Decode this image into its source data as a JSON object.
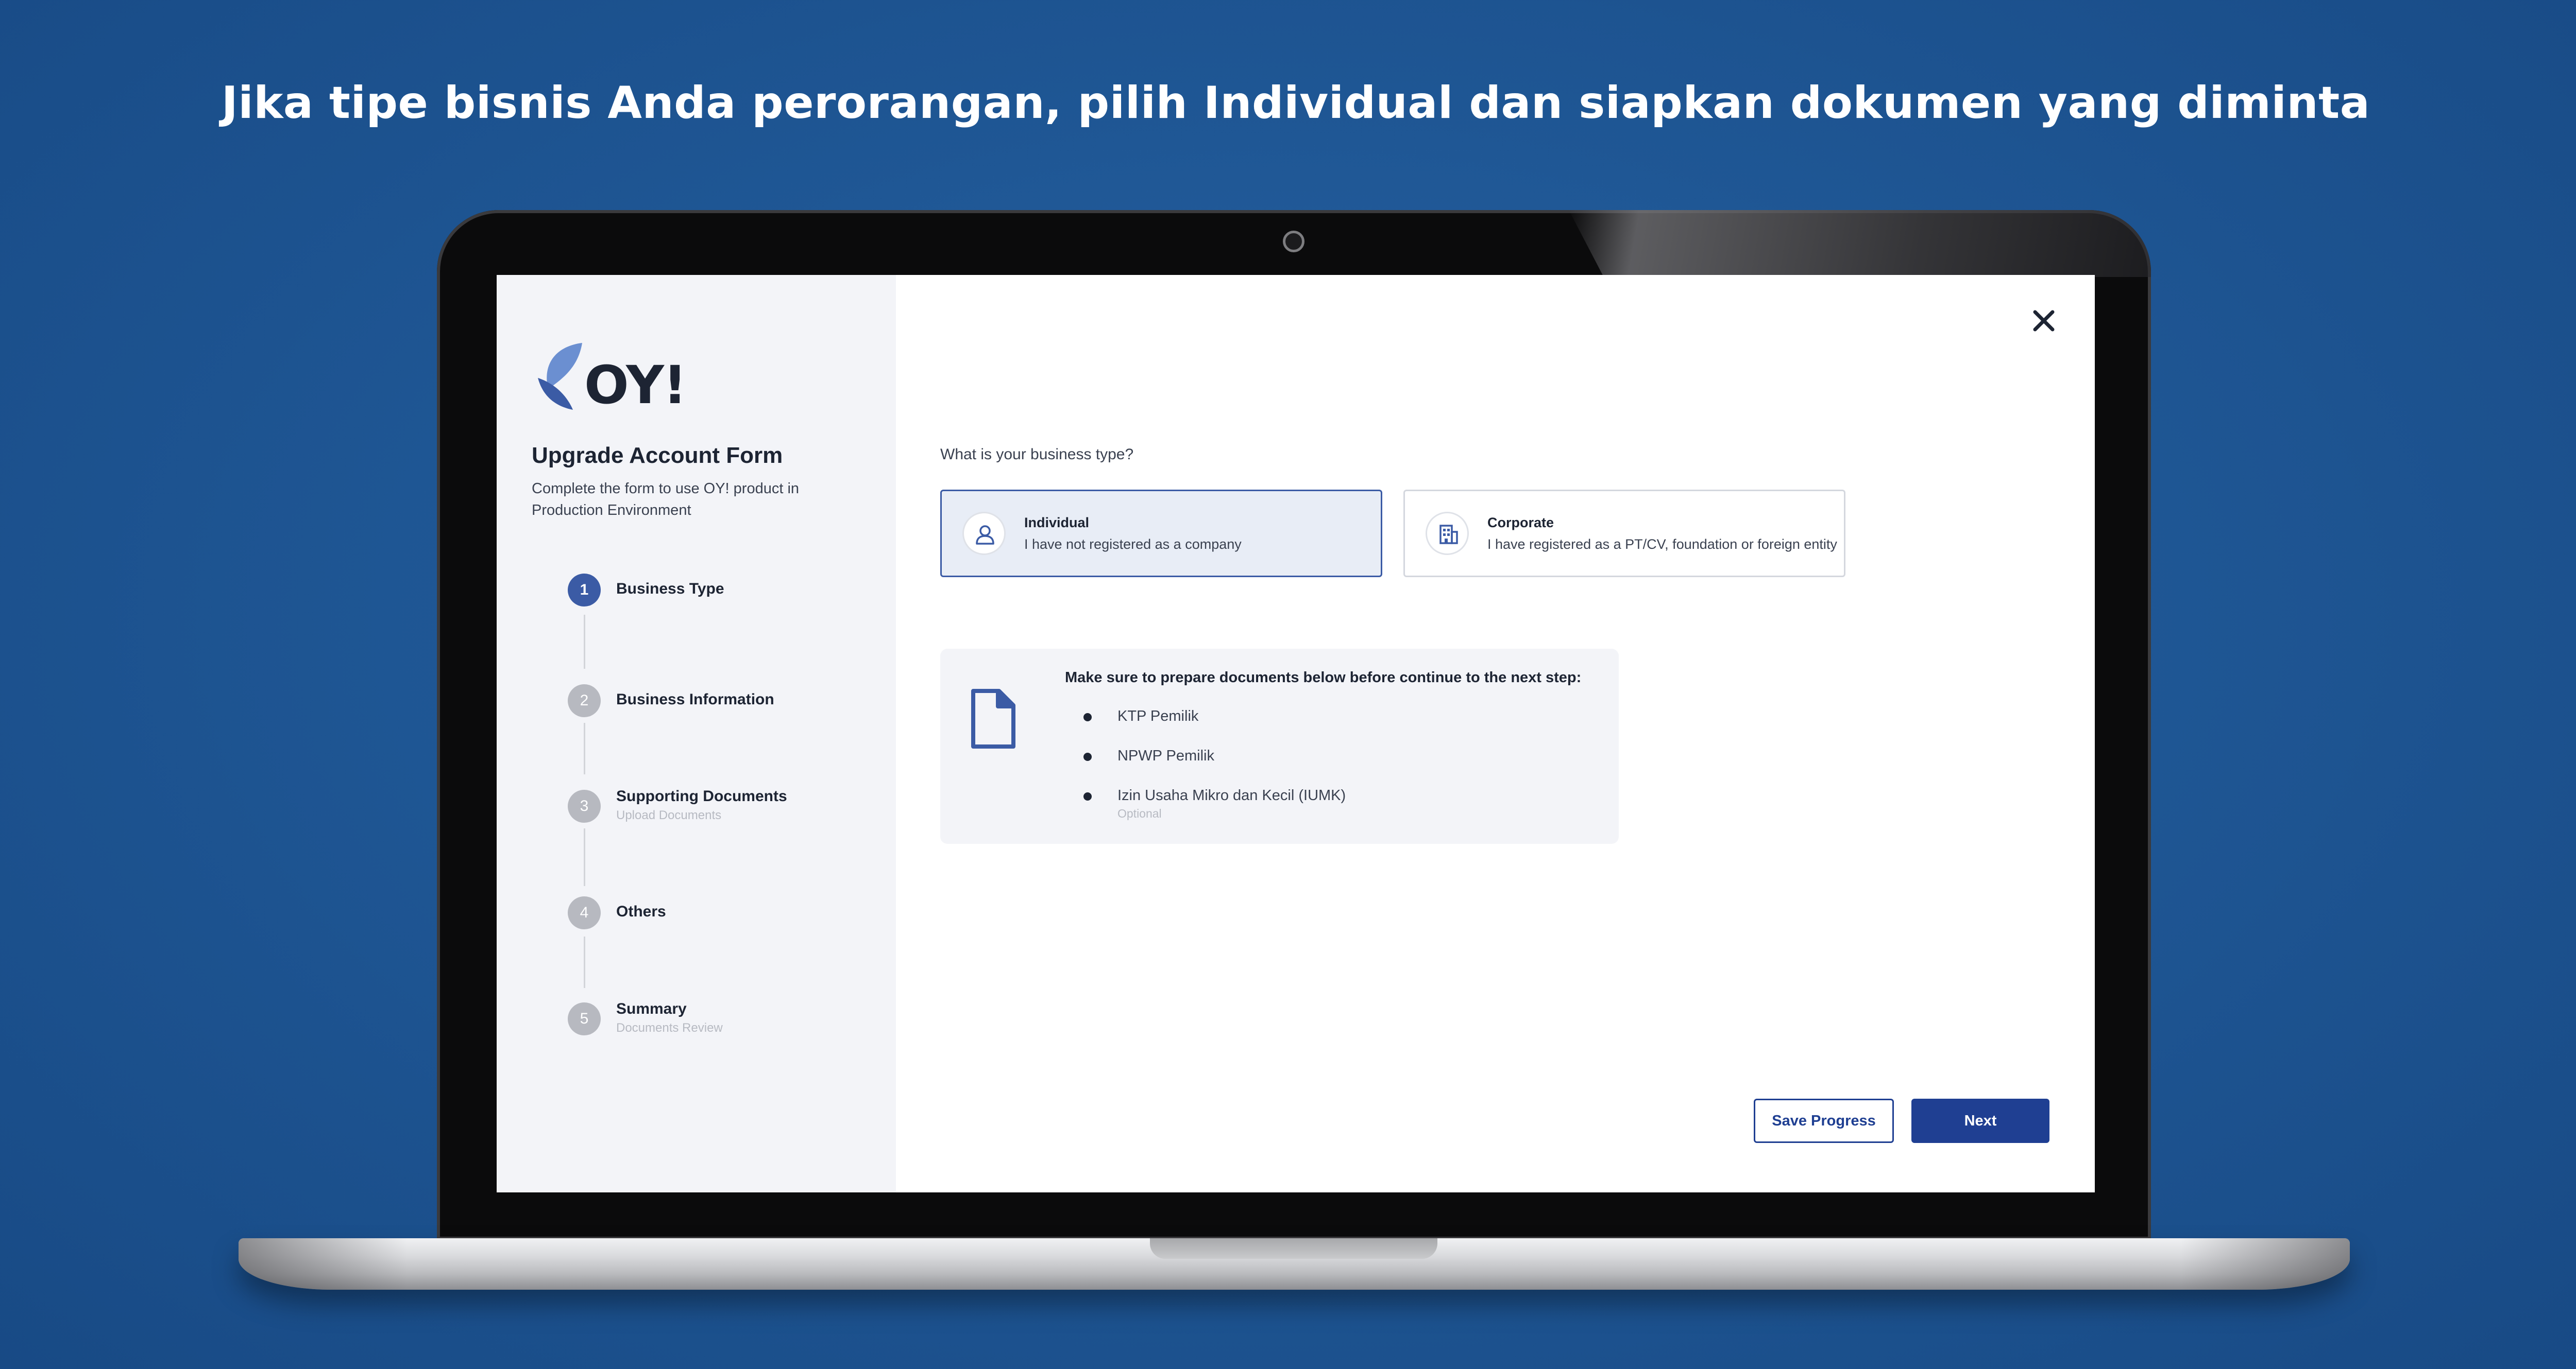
{
  "headline": "Jika tipe bisnis Anda perorangan, pilih Individual dan siapkan dokumen yang diminta",
  "logo": {
    "text": "OY!"
  },
  "sidebar": {
    "title": "Upgrade Account Form",
    "subtitle": "Complete the form to use OY! product in Production Environment",
    "steps": [
      {
        "number": "1",
        "label": "Business Type",
        "sub": "",
        "active": true
      },
      {
        "number": "2",
        "label": "Business Information",
        "sub": ""
      },
      {
        "number": "3",
        "label": "Supporting Documents",
        "sub": "Upload Documents"
      },
      {
        "number": "4",
        "label": "Others",
        "sub": ""
      },
      {
        "number": "5",
        "label": "Summary",
        "sub": "Documents Review"
      }
    ]
  },
  "form": {
    "question": "What is your business type?",
    "options": [
      {
        "title": "Individual",
        "description": "I have not registered as a company",
        "icon": "user-icon",
        "selected": true
      },
      {
        "title": "Corporate",
        "description": "I have registered as a PT/CV, foundation or foreign entity",
        "icon": "building-icon",
        "selected": false
      }
    ],
    "documents": {
      "title": "Make sure to prepare documents below before continue to the next step:",
      "icon": "document-icon",
      "items": [
        {
          "label": "KTP Pemilik",
          "note": ""
        },
        {
          "label": "NPWP Pemilik",
          "note": ""
        },
        {
          "label": "Izin Usaha Mikro dan Kecil (IUMK)",
          "note": "Optional"
        }
      ]
    }
  },
  "actions": {
    "save_label": "Save Progress",
    "next_label": "Next",
    "close_icon": "close-icon"
  },
  "colors": {
    "background": "#1f5795",
    "primary": "#1f3f92",
    "active_step": "#3b5ba5",
    "selected_card": "#e8edf6"
  }
}
